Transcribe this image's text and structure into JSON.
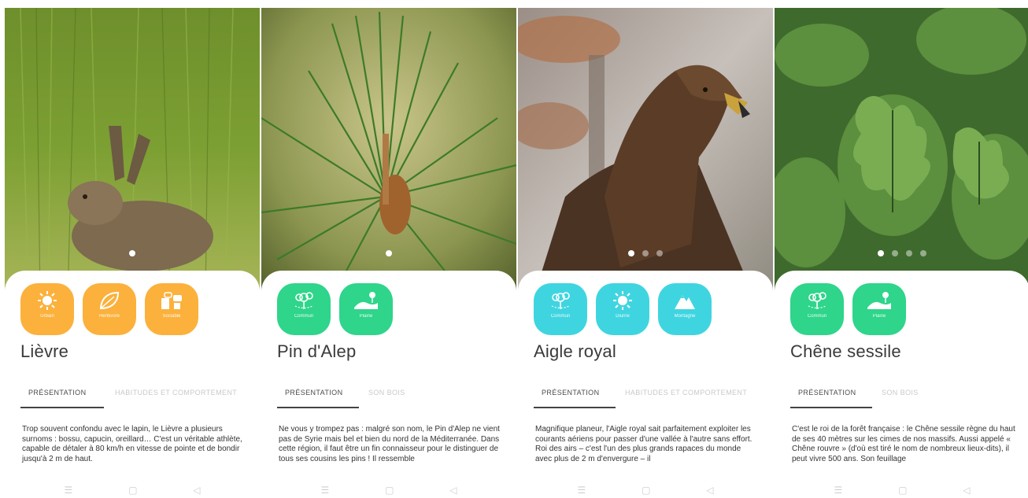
{
  "colors": {
    "orange": "#FBB13C",
    "green": "#2ED58A",
    "cyan": "#3FD5E0"
  },
  "panels": [
    {
      "id": "lievre",
      "dots_count": 1,
      "chips": [
        {
          "label": "Urbain",
          "icon": "sun-icon"
        },
        {
          "label": "Herbivore",
          "icon": "leaf-icon"
        },
        {
          "label": "Sociable",
          "icon": "speech-bubbles-icon"
        }
      ],
      "title": "Lièvre",
      "tabs": [
        "PRÉSENTATION",
        "HABITUDES ET COMPORTEMENT"
      ],
      "description": "Trop souvent confondu avec le lapin, le Lièvre a plusieurs surnoms : bossu, capucin, oreillard… C'est un véritable athlète, capable de détaler à 80 km/h en vitesse de pointe et de bondir jusqu'à 2 m de haut."
    },
    {
      "id": "pin-alep",
      "dots_count": 1,
      "chips": [
        {
          "label": "Commun",
          "icon": "map-pins-icon"
        },
        {
          "label": "Plaine",
          "icon": "plain-landscape-icon"
        }
      ],
      "title": "Pin d'Alep",
      "tabs": [
        "PRÉSENTATION",
        "SON BOIS"
      ],
      "description": "Ne vous y trompez pas : malgré son nom, le Pin d'Alep ne vient pas de Syrie mais bel et bien du nord de la Méditerranée. Dans cette région, il faut être un fin connaisseur pour le distinguer de tous ses cousins les pins ! Il ressemble"
    },
    {
      "id": "aigle-royal",
      "dots_count": 3,
      "chips": [
        {
          "label": "Commun",
          "icon": "map-pins-icon"
        },
        {
          "label": "Diurne",
          "icon": "sun-icon"
        },
        {
          "label": "Montagne",
          "icon": "mountain-icon"
        }
      ],
      "title": "Aigle royal",
      "tabs": [
        "PRÉSENTATION",
        "HABITUDES ET COMPORTEMENT"
      ],
      "description": "Magnifique planeur, l'Aigle royal sait parfaitement exploiter les courants aériens pour passer d'une vallée à l'autre sans effort. Roi des airs – c'est l'un des plus grands rapaces du monde avec plus de 2 m d'envergure – il"
    },
    {
      "id": "chene-sessile",
      "dots_count": 4,
      "chips": [
        {
          "label": "Commun",
          "icon": "map-pins-icon"
        },
        {
          "label": "Plaine",
          "icon": "plain-landscape-icon"
        }
      ],
      "title": "Chêne sessile",
      "tabs": [
        "PRÉSENTATION",
        "SON BOIS"
      ],
      "description": "C'est le roi de la forêt française : le Chêne sessile règne du haut de ses 40 mètres sur les cimes de nos massifs. Aussi appelé « Chêne rouvre » (d'où est tiré le nom de nombreux lieux-dits), il peut vivre 500 ans. Son feuillage"
    }
  ],
  "navbar": {
    "icons": [
      "menu-icon",
      "home-square-icon",
      "back-triangle-icon"
    ]
  }
}
